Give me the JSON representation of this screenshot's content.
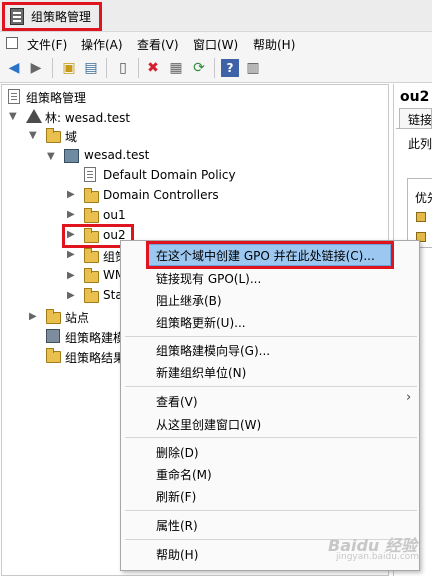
{
  "window": {
    "title": "组策略管理"
  },
  "menubar": {
    "items": [
      "文件(F)",
      "操作(A)",
      "查看(V)",
      "窗口(W)",
      "帮助(H)"
    ]
  },
  "toolbar": {
    "icons": [
      "back-icon",
      "forward-icon",
      "up-folder-icon",
      "show-hide-tree-icon",
      "clipboard-icon",
      "delete-icon",
      "properties-icon",
      "refresh-icon",
      "help-icon",
      "show-pane-icon"
    ]
  },
  "tree": {
    "root": "组策略管理",
    "forest": "林: wesad.test",
    "domains": "域",
    "domain": "wesad.test",
    "items": [
      "Default Domain Policy",
      "Domain Controllers",
      "ou1",
      "ou2",
      "组策",
      "WM",
      "Sta"
    ],
    "sites": "站点",
    "modeling": "组策略建模",
    "results": "组策略结果"
  },
  "right_pane": {
    "title": "ou2",
    "tab": "链接的",
    "desc": "此列",
    "box_label": "优先"
  },
  "context_menu": {
    "items": [
      "在这个域中创建 GPO 并在此处链接(C)...",
      "链接现有 GPO(L)...",
      "阻止继承(B)",
      "组策略更新(U)...",
      "组策略建模向导(G)...",
      "新建组织单位(N)",
      "查看(V)",
      "从这里创建窗口(W)",
      "删除(D)",
      "重命名(M)",
      "刷新(F)",
      "属性(R)",
      "帮助(H)"
    ],
    "submenu_arrow": "›"
  },
  "watermark": {
    "text": "Baidu 经验",
    "sub": "jingyan.baidu.com"
  },
  "colors": {
    "highlight_red": "#e0141e",
    "selection_blue": "#9bc7f0",
    "folder_yellow": "#e9bf4d"
  }
}
